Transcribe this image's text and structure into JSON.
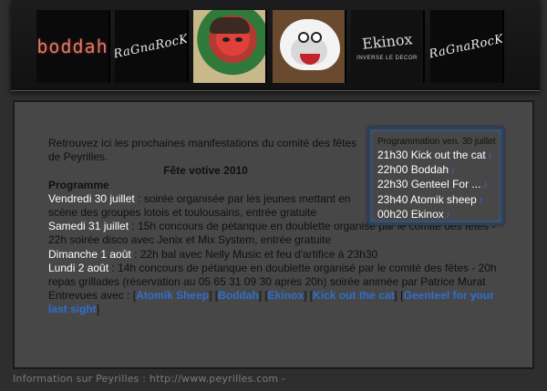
{
  "banner": {
    "images": [
      {
        "name": "boddah-logo",
        "text": "boddah"
      },
      {
        "name": "ragnarock-logo",
        "text": "RaGnaRocK"
      },
      {
        "name": "painting",
        "text": ""
      },
      {
        "name": "atomik-sheep",
        "text": ""
      },
      {
        "name": "ekinox",
        "text": "Ekinox",
        "subtitle": "INVERSE LE DECOR"
      },
      {
        "name": "ragnarock-logo-2",
        "text": "RaGnaRocK"
      }
    ]
  },
  "main": {
    "intro": "Retrouvez ici les prochaines manifestations du comité des fêtes de Peyrilles.",
    "title": "Fête votive 2010",
    "program_label": "Programme",
    "days": [
      {
        "day": "Vendredi 30 juillet",
        "sep": " : ",
        "text": "soirée organisée par les jeunes mettant en scène des groupes lotois et toulousains, entrée gratuite"
      },
      {
        "day": "Samedi 31 juillet",
        "sep": " : ",
        "text": "15h concours de pétanque en doublette organisé par le comité des fêtes - 22h soirée disco avec Jenix et Mix System, entrée gratuite"
      },
      {
        "day": "Dimanche 1 août",
        "sep": " : ",
        "text": "22h bal avec Nelly Music et feu d'artifice à 23h30"
      },
      {
        "day": "Lundi 2 août",
        "sep": " : ",
        "text": "14h concours de pétanque en doublette organisé par le comité des fêtes - 20h repas grillades (réservation au 05 65 31 09 30 après 20h) soirée animée par Patrice Murat"
      }
    ],
    "links_label": "Entrevues avec : ",
    "links": [
      "Atomik Sheep",
      "Boddah",
      "Ekinox",
      "Kick out the cat",
      "Geenteel for your last sight"
    ]
  },
  "program_box": {
    "heading": "Programmation ven. 30 juillet",
    "rows": [
      {
        "time": "21h30",
        "band": "Kick out the cat"
      },
      {
        "time": "22h00",
        "band": "Boddah"
      },
      {
        "time": "22h30",
        "band": "Genteel For ..."
      },
      {
        "time": "23h40",
        "band": "Atomik sheep"
      },
      {
        "time": "00h20",
        "band": "Ekinox"
      }
    ],
    "note_icon": "♪"
  },
  "footer": {
    "text": "Information sur Peyrilles : http://www.peyrilles.com -"
  },
  "colors": {
    "background": "#2e2e2e",
    "panel": "#474747",
    "link": "#2e6fd0",
    "highlight": "#ffffff"
  }
}
